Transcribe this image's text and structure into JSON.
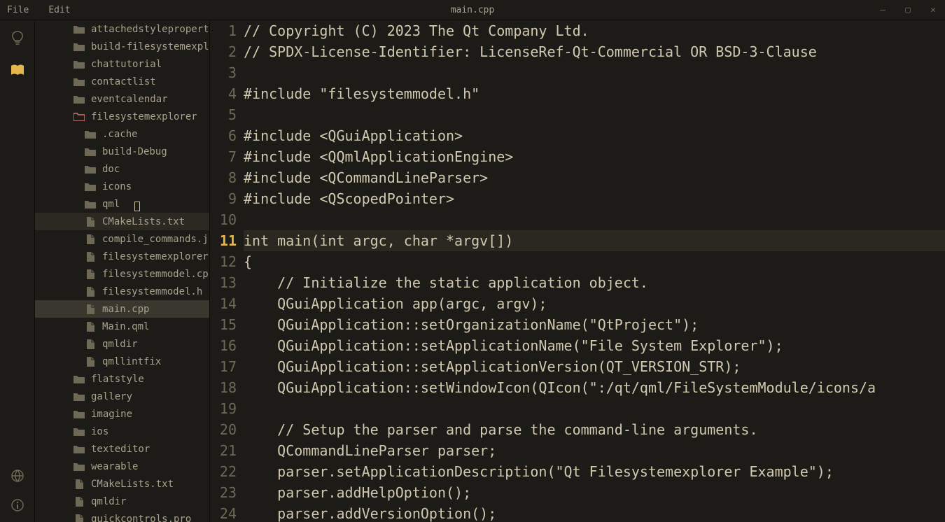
{
  "menu": {
    "file": "File",
    "edit": "Edit"
  },
  "title": "main.cpp",
  "tree": [
    {
      "label": "attachedstylepropertie",
      "type": "folder",
      "indent": 0
    },
    {
      "label": "build-filesystemexplor",
      "type": "folder",
      "indent": 0
    },
    {
      "label": "chattutorial",
      "type": "folder",
      "indent": 0
    },
    {
      "label": "contactlist",
      "type": "folder",
      "indent": 0
    },
    {
      "label": "eventcalendar",
      "type": "folder",
      "indent": 0
    },
    {
      "label": "filesystemexplorer",
      "type": "folder-open",
      "indent": 0
    },
    {
      "label": ".cache",
      "type": "folder",
      "indent": 1
    },
    {
      "label": "build-Debug",
      "type": "folder",
      "indent": 1
    },
    {
      "label": "doc",
      "type": "folder",
      "indent": 1
    },
    {
      "label": "icons",
      "type": "folder",
      "indent": 1
    },
    {
      "label": "qml",
      "type": "folder",
      "indent": 1
    },
    {
      "label": "CMakeLists.txt",
      "type": "file",
      "indent": 1,
      "state": "hover"
    },
    {
      "label": "compile_commands.json",
      "type": "file",
      "indent": 1
    },
    {
      "label": "filesystemexplorer.pr",
      "type": "file",
      "indent": 1
    },
    {
      "label": "filesystemmodel.cpp",
      "type": "file",
      "indent": 1
    },
    {
      "label": "filesystemmodel.h",
      "type": "file",
      "indent": 1
    },
    {
      "label": "main.cpp",
      "type": "file",
      "indent": 1,
      "state": "selected"
    },
    {
      "label": "Main.qml",
      "type": "file",
      "indent": 1
    },
    {
      "label": "qmldir",
      "type": "file",
      "indent": 1
    },
    {
      "label": "qmllintfix",
      "type": "file",
      "indent": 1
    },
    {
      "label": "flatstyle",
      "type": "folder",
      "indent": 0
    },
    {
      "label": "gallery",
      "type": "folder",
      "indent": 0
    },
    {
      "label": "imagine",
      "type": "folder",
      "indent": 0
    },
    {
      "label": "ios",
      "type": "folder",
      "indent": 0
    },
    {
      "label": "texteditor",
      "type": "folder",
      "indent": 0
    },
    {
      "label": "wearable",
      "type": "folder",
      "indent": 0
    },
    {
      "label": "CMakeLists.txt",
      "type": "file",
      "indent": 0
    },
    {
      "label": "qmldir",
      "type": "file",
      "indent": 0
    },
    {
      "label": "quickcontrols.pro",
      "type": "file",
      "indent": 0
    }
  ],
  "current_line": 11,
  "code": [
    "// Copyright (C) 2023 The Qt Company Ltd.",
    "// SPDX-License-Identifier: LicenseRef-Qt-Commercial OR BSD-3-Clause",
    "",
    "#include \"filesystemmodel.h\"",
    "",
    "#include <QGuiApplication>",
    "#include <QQmlApplicationEngine>",
    "#include <QCommandLineParser>",
    "#include <QScopedPointer>",
    "",
    "int main(int argc, char *argv[])",
    "{",
    "    // Initialize the static application object.",
    "    QGuiApplication app(argc, argv);",
    "    QGuiApplication::setOrganizationName(\"QtProject\");",
    "    QGuiApplication::setApplicationName(\"File System Explorer\");",
    "    QGuiApplication::setApplicationVersion(QT_VERSION_STR);",
    "    QGuiApplication::setWindowIcon(QIcon(\":/qt/qml/FileSystemModule/icons/a",
    "",
    "    // Setup the parser and parse the command-line arguments.",
    "    QCommandLineParser parser;",
    "    parser.setApplicationDescription(\"Qt Filesystemexplorer Example\");",
    "    parser.addHelpOption();",
    "    parser.addVersionOption();"
  ]
}
